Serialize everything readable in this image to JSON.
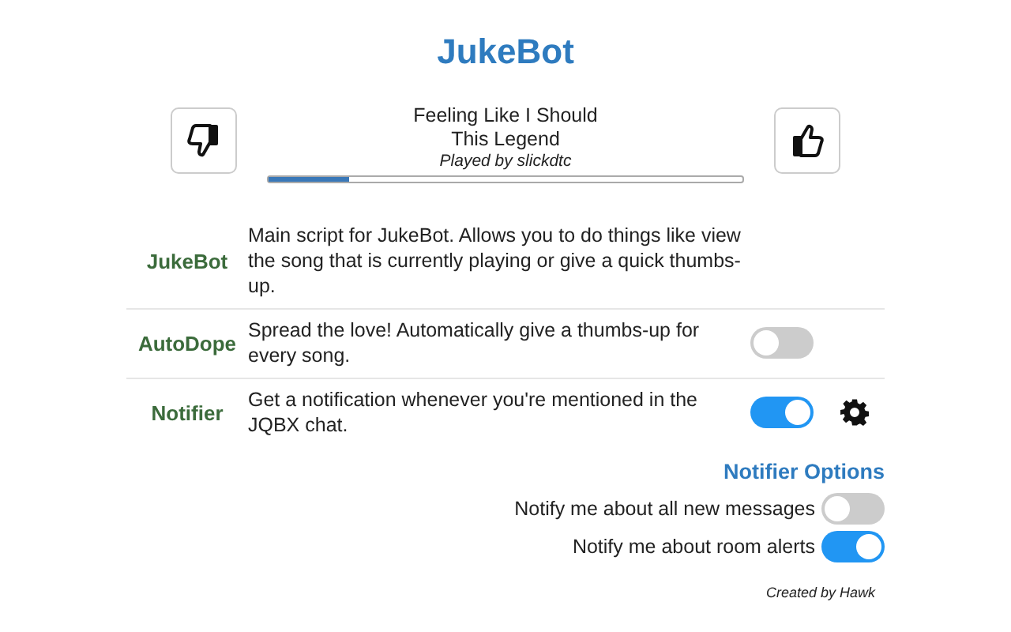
{
  "title": "JukeBot",
  "player": {
    "song": "Feeling Like I Should",
    "artist": "This Legend",
    "played_by": "Played by slickdtc",
    "level": 0.17
  },
  "scripts": [
    {
      "kind": "info",
      "name": "JukeBot",
      "description": "Main script for JukeBot. Allows you to do things like view the song that is currently playing or give a quick thumbs-up."
    },
    {
      "kind": "toggle",
      "name": "AutoDope",
      "description": "Spread the love! Automatically give a thumbs-up for every song.",
      "on": false
    },
    {
      "kind": "toggle_settings",
      "name": "Notifier",
      "description": "Get a notification whenever you're mentioned in the JQBX chat.",
      "on": true
    }
  ],
  "options_title": "Notifier Options",
  "options": [
    {
      "label": "Notify me about all new messages",
      "on": false
    },
    {
      "label": "Notify me about room alerts",
      "on": true
    }
  ],
  "footer": "Created by Hawk"
}
